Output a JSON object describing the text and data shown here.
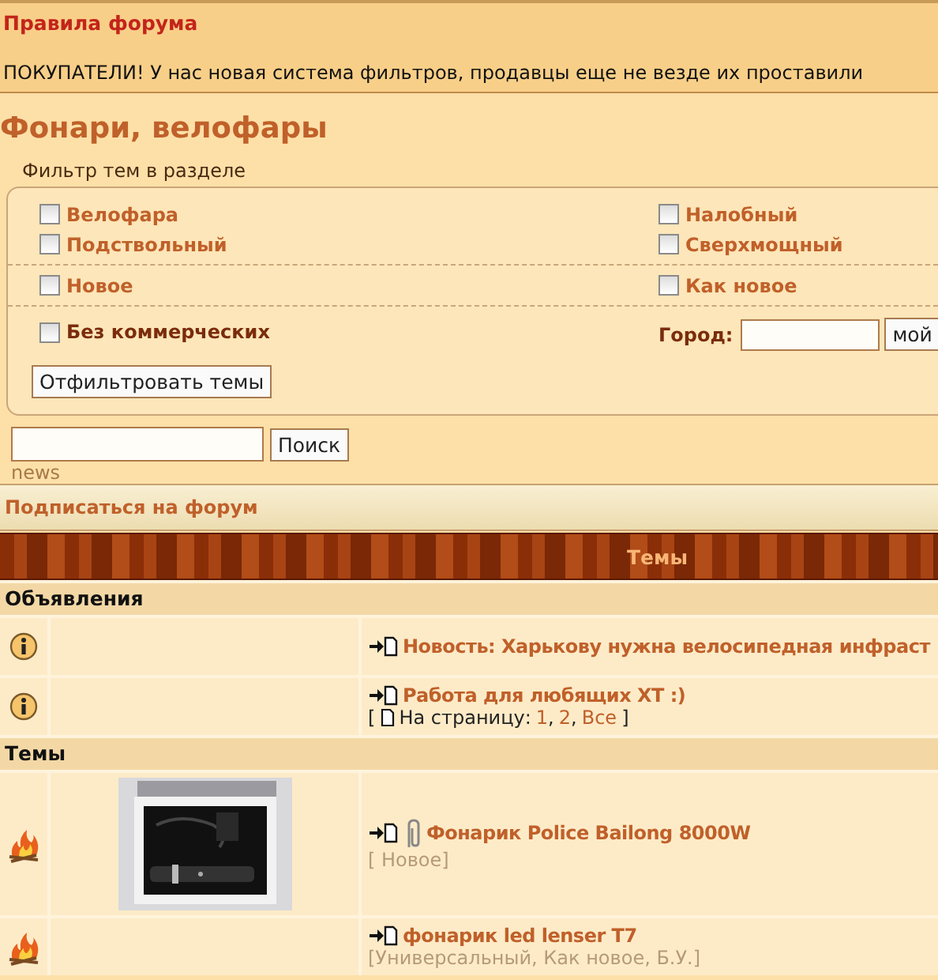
{
  "rules": {
    "title": "Правила форума",
    "text": "ПОКУПАТЕЛИ! У нас новая система фильтров, продавцы еще не везде их проставили"
  },
  "forum_title": "Фонари, велофары",
  "filter": {
    "label": "Фильтр тем в разделе",
    "groups": [
      {
        "items": [
          {
            "label": "Велофара",
            "checked": false,
            "kind": "normal"
          },
          {
            "label": "Налобный",
            "checked": false,
            "kind": "normal"
          },
          {
            "label": "Подствольный",
            "checked": false,
            "kind": "normal"
          },
          {
            "label": "Сверхмощный",
            "checked": false,
            "kind": "normal"
          }
        ]
      },
      {
        "items": [
          {
            "label": "Новое",
            "checked": false,
            "kind": "normal"
          },
          {
            "label": "Как новое",
            "checked": false,
            "kind": "normal"
          }
        ]
      },
      {
        "items": [
          {
            "label": "Без коммерческих",
            "checked": false,
            "kind": "strong"
          }
        ],
        "city": {
          "label": "Город:",
          "button": "мой"
        }
      }
    ],
    "button": "Отфильтровать темы"
  },
  "search": {
    "button": "Поиск"
  },
  "news_link": "news",
  "subscribe": "Подписаться на форум",
  "table_header": "Темы",
  "sections": [
    {
      "title": "Объявления",
      "rows": [
        {
          "kind": "info",
          "picture": false,
          "attachment": false,
          "title": "Новость: Харькову нужна велосипедная инфраст"
        },
        {
          "kind": "info",
          "picture": false,
          "attachment": false,
          "title": "Работа для любящих XT :)",
          "pages": {
            "open": "[",
            "label": "На страницу:",
            "links": [
              "1",
              "2",
              "Все"
            ],
            "separator": ",",
            "close": "]"
          }
        }
      ]
    },
    {
      "title": "Темы",
      "rows": [
        {
          "kind": "hot",
          "picture": true,
          "attachment": true,
          "title": "Фонарик Police Bailong 8000W",
          "tags": "[ Новое]"
        },
        {
          "kind": "hot",
          "picture": false,
          "attachment": false,
          "title": "фонарик led lenser T7",
          "tags": "[Универсальный, Как новое, Б.У.]"
        }
      ]
    }
  ]
}
